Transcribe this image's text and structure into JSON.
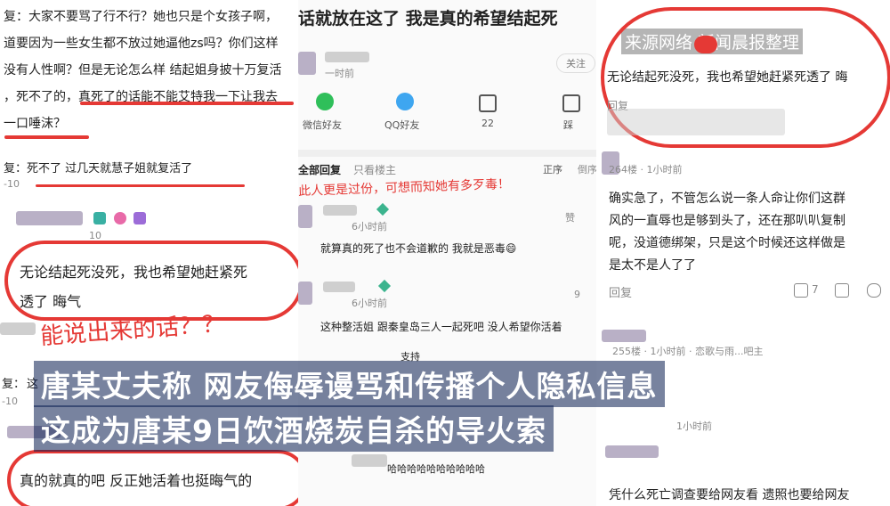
{
  "left": {
    "line1": "复：大家不要骂了行不行？她也只是个女孩子啊，",
    "line2": "道要因为一些女生都不放过她逼他zs吗？你们这样",
    "line3": "没有人性啊？但是无论怎么样 结起姐身披十万复活",
    "line4": "，死不了的，真死了的话能不能艾特我一下让我去",
    "line5": "一口唾沫？",
    "reply2": "复：死不了 过几天就慧子姐就复活了",
    "date1": "-10",
    "date2": "10",
    "quote1": "无论结起死没死，我也希望她赶紧死",
    "quote2": "透了 晦气",
    "annotation": "能说出来的话？？",
    "reply3_prefix": "复：",
    "reply3_text": "这",
    "date3": "-10",
    "quote3": "真的就真的吧 反正她活着也挺晦气的"
  },
  "mid": {
    "header": "话就放在这了 我是真的希望结起死",
    "user_time": "一时前",
    "follow": "关注",
    "share": [
      "微信好友",
      "QQ好友",
      "22",
      "踩"
    ],
    "tabs": [
      "全部回复",
      "只看楼主",
      "正序",
      "倒序"
    ],
    "annotation": "此人更是过份，可想而知她有多歹毒！",
    "c1_time": "6小时前",
    "c1_like": "赞",
    "c1_text": "就算真的死了也不会道歉的 我就是恶毒😄",
    "c2_time": "6小时前",
    "c2_like": "9",
    "c2_text": "这种整活姐 跟秦皇岛三人一起死吧 没人希望你活着",
    "c3_text": "支持",
    "c4_text": "哈哈哈哈哈哈哈哈哈哈"
  },
  "right": {
    "watermark": "来源网络 新闻晨报整理",
    "quote": "无论结起死没死，我也希望她赶紧死透了 晦",
    "reply_label": "回复",
    "floor1": "264楼 · 1小时前",
    "c1_line1": "确实急了，不管怎么说一条人命让你们这群",
    "c1_line2": "风的一直辱也是够到头了，还在那叭叭复制",
    "c1_line3": "呢，没道德绑架，只是这个时候还这样做是",
    "c1_line4": "是太不是人了了",
    "c1_reply": "回复",
    "c1_likes": "7",
    "floor2": "255楼 · 1小时前 · 恋歌与雨...吧主",
    "floor3": "1小时前",
    "bottom_line": "凭什么死亡调查要给网友看 遗照也要给网友"
  },
  "caption": {
    "line1": "唐某丈夫称 网友侮辱谩骂和传播个人隐私信息",
    "line2": "这成为唐某9日饮酒烧炭自杀的导火索"
  }
}
